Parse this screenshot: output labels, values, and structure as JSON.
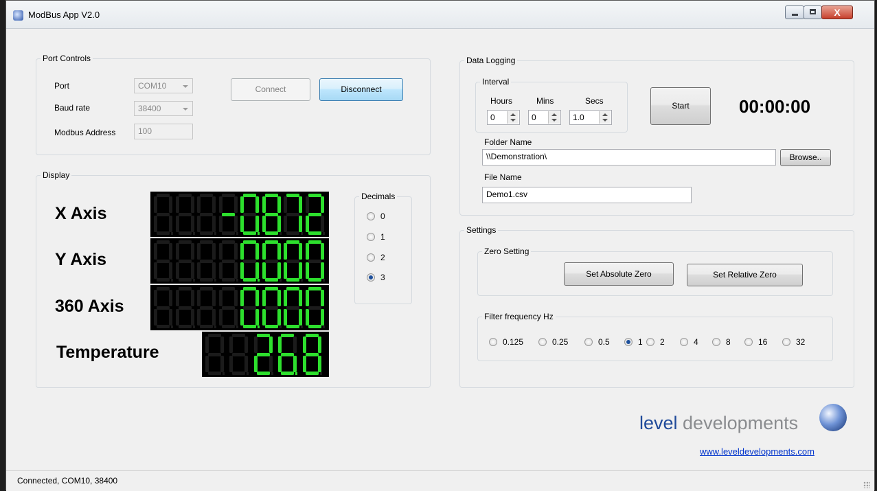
{
  "window": {
    "title": "ModBus App V2.0",
    "close_glyph": "X"
  },
  "port_controls": {
    "title": "Port Controls",
    "port_label": "Port",
    "port_value": "COM10",
    "baud_label": "Baud rate",
    "baud_value": "38400",
    "address_label": "Modbus Address",
    "address_value": "100",
    "connect_label": "Connect",
    "disconnect_label": "Disconnect"
  },
  "display": {
    "title": "Display",
    "readouts": [
      {
        "label": "X Axis",
        "value": "-0.872"
      },
      {
        "label": "Y Axis",
        "value": "0.000"
      },
      {
        "label": "360 Axis",
        "value": "0.000"
      },
      {
        "label": "Temperature",
        "value": "26.8"
      }
    ],
    "decimals": {
      "title": "Decimals",
      "options": [
        "0",
        "1",
        "2",
        "3"
      ],
      "selected": "3"
    },
    "segment_on_color": "#2de02d",
    "segment_off_color": "#1b1b1b"
  },
  "data_logging": {
    "title": "Data Logging",
    "interval_title": "Interval",
    "hours_label": "Hours",
    "mins_label": "Mins",
    "secs_label": "Secs",
    "hours_value": "0",
    "mins_value": "0",
    "secs_value": "1.0",
    "start_label": "Start",
    "timer": "00:00:00",
    "folder_label": "Folder Name",
    "folder_value": "\\\\Demonstration\\",
    "browse_label": "Browse..",
    "file_label": "File Name",
    "file_value": "Demo1.csv"
  },
  "settings": {
    "title": "Settings",
    "zero_title": "Zero Setting",
    "abs_zero_label": "Set Absolute Zero",
    "rel_zero_label": "Set Relative Zero",
    "filter_title": "Filter frequency Hz",
    "filter_options": [
      "0.125",
      "0.25",
      "0.5",
      "1",
      "2",
      "4",
      "8",
      "16",
      "32"
    ],
    "filter_selected": "1"
  },
  "branding": {
    "logo_bold": "level",
    "logo_light": " developments",
    "url": "www.leveldevelopments.com"
  },
  "status": {
    "text": "Connected, COM10, 38400"
  }
}
